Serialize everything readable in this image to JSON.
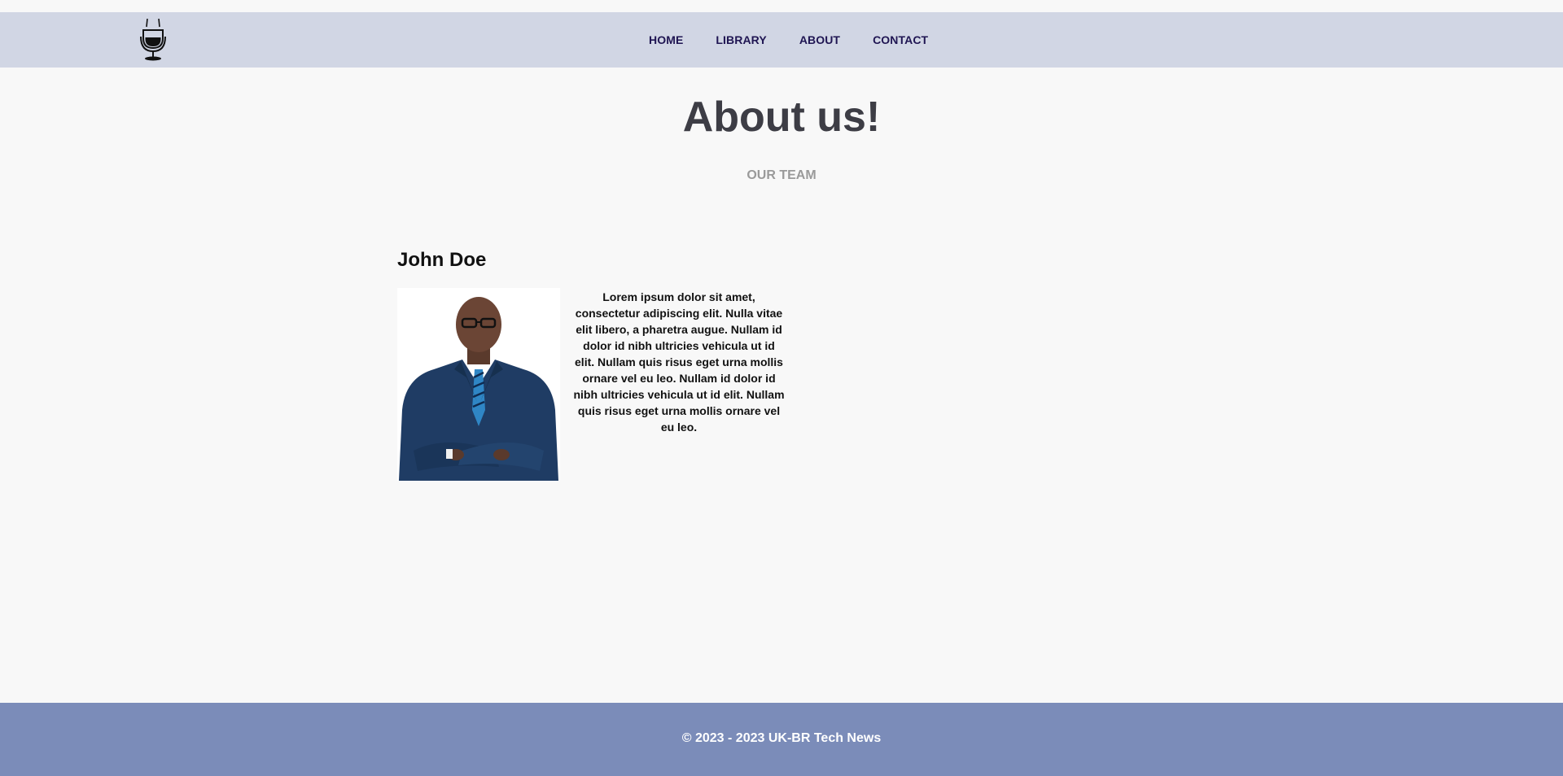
{
  "nav": {
    "logo_icon": "microphone-icon",
    "links": [
      "HOME",
      "LIBRARY",
      "ABOUT",
      "CONTACT"
    ]
  },
  "main": {
    "title": "About us!",
    "subtitle": "OUR TEAM",
    "members": [
      {
        "name": "John Doe",
        "photo_icon": "team-member-photo",
        "bio": "Lorem ipsum dolor sit amet, consectetur adipiscing elit. Nulla vitae elit libero, a pharetra augue. Nullam id dolor id nibh ultricies vehicula ut id elit. Nullam quis risus eget urna mollis ornare vel eu leo. Nullam id dolor id nibh ultricies vehicula ut id elit. Nullam quis risus eget urna mollis ornare vel eu leo."
      }
    ]
  },
  "footer": {
    "text": "© 2023 - 2023 UK-BR Tech News"
  },
  "colors": {
    "navbar_bg": "#d1d6e4",
    "nav_link": "#1f1552",
    "footer_bg": "#7b8cb9",
    "page_bg": "#f8f8f8"
  }
}
